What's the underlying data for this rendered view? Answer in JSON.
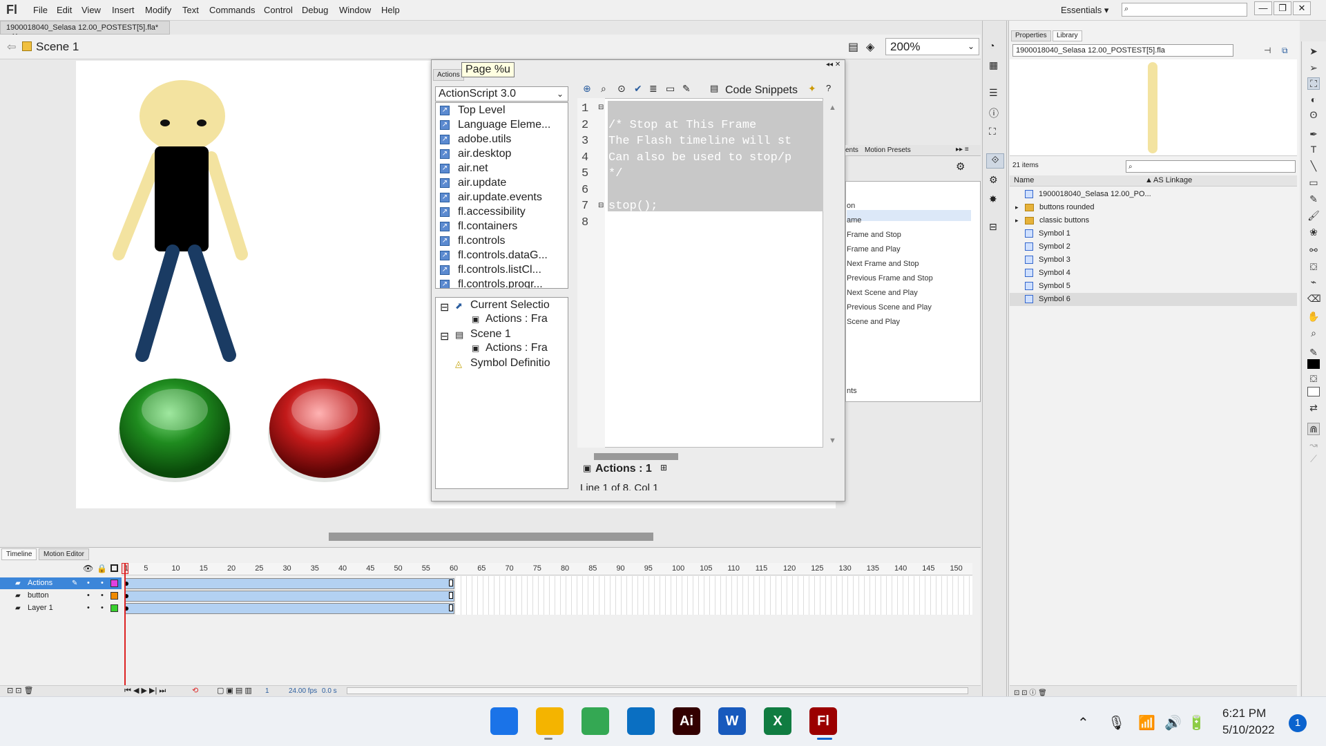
{
  "menubar": {
    "logo": "Fl",
    "items": [
      "File",
      "Edit",
      "View",
      "Insert",
      "Modify",
      "Text",
      "Commands",
      "Control",
      "Debug",
      "Window",
      "Help"
    ],
    "workspace": "Essentials",
    "window_buttons": [
      "—",
      "❐",
      "✕"
    ]
  },
  "document": {
    "tab": "1900018040_Selasa 12.00_POSTEST[5].fla*",
    "scene": "Scene 1",
    "zoom": "200%"
  },
  "actions_panel": {
    "tab": "Actions",
    "tooltip": "Page %u",
    "language": "ActionScript 3.0",
    "packages": [
      "Top Level",
      "Language Eleme...",
      "adobe.utils",
      "air.desktop",
      "air.net",
      "air.update",
      "air.update.events",
      "fl.accessibility",
      "fl.containers",
      "fl.controls",
      "fl.controls.dataG...",
      "fl.controls.listCl...",
      "fl.controls.progr..."
    ],
    "tree": {
      "current_selection": "Current Selectio",
      "actions_frame_1": "Actions : Fra",
      "scene": "Scene 1",
      "actions_frame_2": "Actions : Fra",
      "symbol_definitions": "Symbol Definitio"
    },
    "code_snippets_label": "Code Snippets",
    "line_numbers": [
      "1",
      "2",
      "3",
      "4",
      "5",
      "6",
      "7",
      "8"
    ],
    "code_lines": [
      "",
      "/* Stop at This Frame",
      "The Flash timeline will st",
      "Can also be used to stop/p",
      "*/",
      "",
      "stop();",
      ""
    ],
    "frame_tab": "Actions : 1",
    "status": "Line 1 of 8, Col 1"
  },
  "snippets_panel": {
    "tabs": [
      "ents",
      "Motion Presets"
    ],
    "items": [
      "on",
      "ame",
      "Frame and Stop",
      "Frame and Play",
      "Next Frame and Stop",
      "Previous Frame and Stop",
      "Next Scene and Play",
      "Previous Scene and Play",
      "Scene and Play",
      "nts"
    ]
  },
  "timeline": {
    "tabs": [
      "Timeline",
      "Motion Editor"
    ],
    "ticks": [
      "1",
      "5",
      "10",
      "15",
      "20",
      "25",
      "30",
      "35",
      "40",
      "45",
      "50",
      "55",
      "60",
      "65",
      "70",
      "75",
      "80",
      "85",
      "90",
      "95",
      "100",
      "105",
      "110",
      "115",
      "120",
      "125",
      "130",
      "135",
      "140",
      "145",
      "150"
    ],
    "layers": [
      {
        "name": "Actions",
        "color": "#e040e0",
        "selected": true
      },
      {
        "name": "button",
        "color": "#f08a00",
        "selected": false
      },
      {
        "name": "Layer 1",
        "color": "#39d02e",
        "selected": false
      }
    ],
    "current_frame": "1",
    "fps": "24.00 fps",
    "time": "0.0 s"
  },
  "library": {
    "tabs": [
      "Properties",
      "Library"
    ],
    "file": "1900018040_Selasa 12.00_POSTEST[5].fla",
    "item_count": "21 items",
    "columns": [
      "Name",
      "AS Linkage"
    ],
    "items": [
      {
        "name": "1900018040_Selasa 12.00_PO...",
        "type": "symbol"
      },
      {
        "name": "buttons rounded",
        "type": "folder"
      },
      {
        "name": "classic buttons",
        "type": "folder"
      },
      {
        "name": "Symbol 1",
        "type": "symbol"
      },
      {
        "name": "Symbol 2",
        "type": "symbol"
      },
      {
        "name": "Symbol 3",
        "type": "symbol"
      },
      {
        "name": "Symbol 4",
        "type": "symbol"
      },
      {
        "name": "Symbol 5",
        "type": "symbol"
      },
      {
        "name": "Symbol 6",
        "type": "symbol"
      }
    ]
  },
  "taskbar": {
    "apps": [
      {
        "name": "start-icon",
        "label": "",
        "color": "#1a73e8"
      },
      {
        "name": "file-explorer-icon",
        "label": "",
        "color": "#f4b400"
      },
      {
        "name": "chrome-icon",
        "label": "",
        "color": "#34a853"
      },
      {
        "name": "vscode-icon",
        "label": "",
        "color": "#0a6fc2"
      },
      {
        "name": "illustrator-icon",
        "label": "Ai",
        "color": "#330000"
      },
      {
        "name": "word-icon",
        "label": "W",
        "color": "#185abd"
      },
      {
        "name": "excel-icon",
        "label": "X",
        "color": "#107c41"
      },
      {
        "name": "animate-icon",
        "label": "Fl",
        "color": "#9b0000"
      }
    ],
    "time": "6:21 PM",
    "date": "5/10/2022",
    "notifications": "1"
  },
  "colors": {
    "skin": "#f3e3a0",
    "shirt": "#000000",
    "pants": "#1a3b63",
    "green_button": "#1f8b1f",
    "red_button": "#c21a1a",
    "frame_span": "#b3d1f2",
    "playhead": "#dd2222"
  }
}
